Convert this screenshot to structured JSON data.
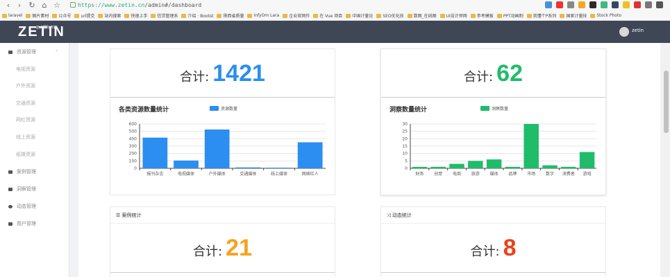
{
  "browser": {
    "url_host": "https://www.zetin.cn",
    "url_path": "/admin#/dashboard",
    "bookmarks": [
      "laravel",
      "图片素材",
      "公众号",
      "url提交",
      "站内搜索",
      "快速上手",
      "信贷管理系",
      "介绍 · Bootst",
      "陕西省质量",
      "InfyOm Lara",
      "企业官网作",
      "在 Vue 项目",
      "中国计量论",
      "SEO优化技",
      "数图_在线图",
      "UI设计师网",
      "参考模板",
      "PPT动画制",
      "我懂个P系列",
      "国家计量技",
      "Stock Photo"
    ]
  },
  "header": {
    "logo": "ZETIN",
    "logo_sub": "正点国际传媒",
    "user": "zetin"
  },
  "sidebar": {
    "group": "资源管理",
    "sub_items": [
      "电视资源",
      "户外资源",
      "交通资源",
      "网红资源",
      "线上资源",
      "纸媒资源"
    ],
    "items": [
      "案例管理",
      "洞察管理",
      "动态管理",
      "用户管理"
    ]
  },
  "cards": {
    "resources": {
      "label": "合计:",
      "value": "1421",
      "color": "#2b8ef0"
    },
    "insights": {
      "label": "合计:",
      "value": "62",
      "color": "#1fbc6a"
    },
    "cases": {
      "head": "案例统计",
      "label": "合计:",
      "value": "21",
      "color": "#f7a21b"
    },
    "news": {
      "head": "动态统计",
      "label": "合计:",
      "value": "8",
      "color": "#e8431c"
    }
  },
  "chart_data": [
    {
      "type": "bar",
      "title": "各类资源数量统计",
      "series": [
        {
          "name": "资源数量",
          "values": [
            415,
            105,
            525,
            12,
            8,
            352
          ]
        }
      ],
      "categories": [
        "报刊杂志",
        "电视媒体",
        "户外媒体",
        "交通媒体",
        "线上媒体",
        "网络红人"
      ],
      "yticks": [
        0,
        100,
        200,
        300,
        400,
        500,
        600
      ],
      "ylim": [
        0,
        600
      ],
      "grid": true,
      "legend": "top",
      "color": "#2b8ef0"
    },
    {
      "type": "bar",
      "title": "洞察数量统计",
      "series": [
        {
          "name": "洞察数量",
          "values": [
            1,
            1,
            3,
            5,
            6,
            1,
            30,
            2,
            1,
            11
          ]
        }
      ],
      "categories": [
        "财务",
        "创意",
        "电商",
        "旅游",
        "媒体",
        "品牌",
        "市场",
        "数字",
        "消费者",
        "游戏"
      ],
      "yticks": [
        0,
        5,
        10,
        15,
        20,
        25,
        30
      ],
      "ylim": [
        0,
        30
      ],
      "grid": true,
      "legend": "top",
      "color": "#1fbc6a"
    }
  ]
}
